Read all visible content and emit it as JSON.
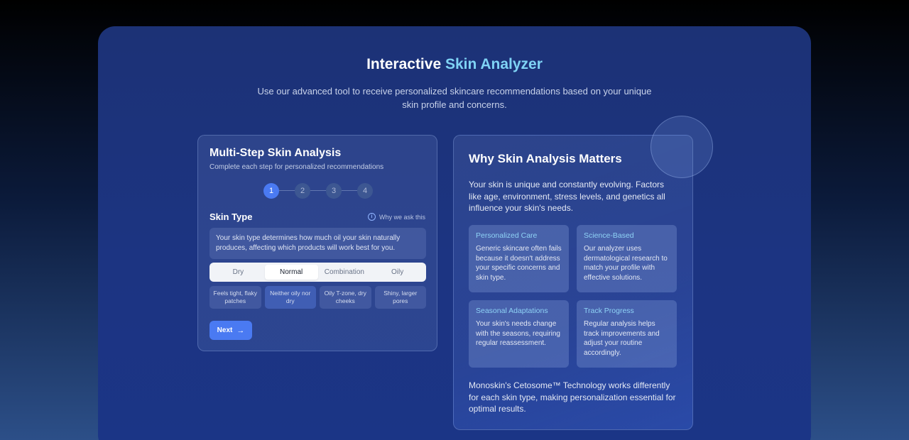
{
  "header": {
    "title_part1": "Interactive ",
    "title_part2": "Skin Analyzer",
    "subtitle": "Use our advanced tool to receive personalized skincare recommendations based on your unique skin profile and concerns."
  },
  "analysis": {
    "title": "Multi-Step Skin Analysis",
    "subtitle": "Complete each step for personalized recommendations",
    "steps": [
      "1",
      "2",
      "3",
      "4"
    ],
    "active_step": 1,
    "section_title": "Skin Type",
    "why_label": "Why we ask this",
    "description": "Your skin type determines how much oil your skin naturally produces, affecting which products will work best for you.",
    "options": [
      {
        "label": "Dry",
        "hint": "Feels tight, flaky patches"
      },
      {
        "label": "Normal",
        "hint": "Neither oily nor dry"
      },
      {
        "label": "Combination",
        "hint": "Oily T-zone, dry cheeks"
      },
      {
        "label": "Oily",
        "hint": "Shiny, larger pores"
      }
    ],
    "selected_option": "Normal",
    "next_label": "Next"
  },
  "why_matters": {
    "title": "Why Skin Analysis Matters",
    "intro": "Your skin is unique and constantly evolving. Factors like age, environment, stress levels, and genetics all influence your skin's needs.",
    "features": [
      {
        "title": "Personalized Care",
        "text": "Generic skincare often fails because it doesn't address your specific concerns and skin type."
      },
      {
        "title": "Science-Based",
        "text": "Our analyzer uses dermatological research to match your profile with effective solutions."
      },
      {
        "title": "Seasonal Adaptations",
        "text": "Your skin's needs change with the seasons, requiring regular reassessment."
      },
      {
        "title": "Track Progress",
        "text": "Regular analysis helps track improvements and adjust your routine accordingly."
      }
    ],
    "outro": "Monoskin's Cetosome™ Technology works differently for each skin type, making personalization essential for optimal results."
  },
  "colors": {
    "accent": "#4a7af2",
    "title_accent": "#7fd3f5",
    "feature_title": "#8fd3f6"
  }
}
